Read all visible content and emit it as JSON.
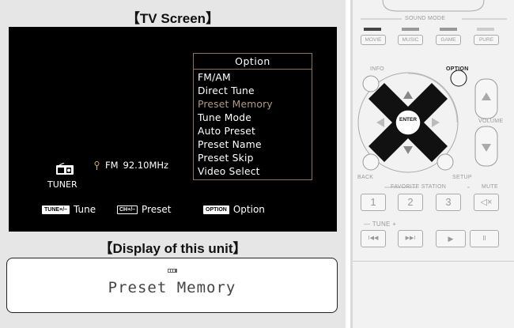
{
  "titles": {
    "tv_screen": "【TV Screen】",
    "display_unit": "【Display of this unit】"
  },
  "tv": {
    "menu_header": "Option",
    "menu_items": [
      "FM/AM",
      "Direct Tune",
      "Preset Memory",
      "Tune Mode",
      "Auto Preset",
      "Preset Name",
      "Preset Skip",
      "Video Select"
    ],
    "selected_item": "Preset Memory",
    "source_label": "TUNER",
    "band": "FM",
    "frequency": "92.10MHz",
    "hints": [
      {
        "badge": "TUNE+/–",
        "label": "Tune"
      },
      {
        "badge": "CH+/–",
        "label": "Preset"
      },
      {
        "badge": "OPTION",
        "label": "Option"
      }
    ]
  },
  "unit_display": {
    "text": "Preset Memory"
  },
  "remote": {
    "sound_mode_label": "SOUND MODE",
    "mode_buttons": [
      "MOVIE",
      "MUSIC",
      "GAME",
      "PURE"
    ],
    "info_label": "INFO",
    "option_label": "OPTION",
    "enter_label": "ENTER",
    "volume_label": "VOLUME",
    "back_label": "BACK",
    "setup_label": "SETUP",
    "favorite_label": "FAVORITE STATION",
    "mute_label": "MUTE",
    "numbers": [
      "1",
      "2",
      "3"
    ],
    "tune_label": "TUNE",
    "accent_color": "#111111"
  }
}
